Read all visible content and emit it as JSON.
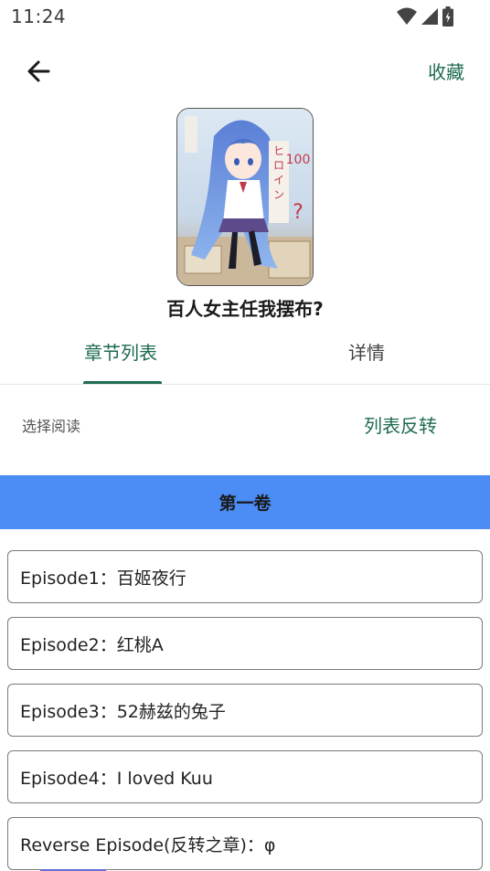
{
  "status_bar": {
    "time": "11:24"
  },
  "header": {
    "favorite_label": "收藏"
  },
  "book": {
    "title": "百人女主任我摆布?"
  },
  "tabs": [
    {
      "label": "章节列表",
      "active": true
    },
    {
      "label": "详情",
      "active": false
    }
  ],
  "toolbar": {
    "select_label": "选择阅读",
    "reverse_label": "列表反转"
  },
  "volume": {
    "title": "第一卷"
  },
  "chapters": [
    {
      "label": "Episode1：百姬夜行"
    },
    {
      "label": "Episode2：红桃A"
    },
    {
      "label": "Episode3：52赫兹的兔子"
    },
    {
      "label": "Episode4：I loved Kuu"
    },
    {
      "label": "Reverse Episode(反转之章)：φ"
    }
  ],
  "colors": {
    "accent": "#1e6b4f",
    "volume_header": "#4b8cf5"
  },
  "icons": {
    "back": "arrow-left-icon",
    "wifi": "wifi-icon",
    "signal": "signal-icon",
    "battery": "battery-icon"
  }
}
